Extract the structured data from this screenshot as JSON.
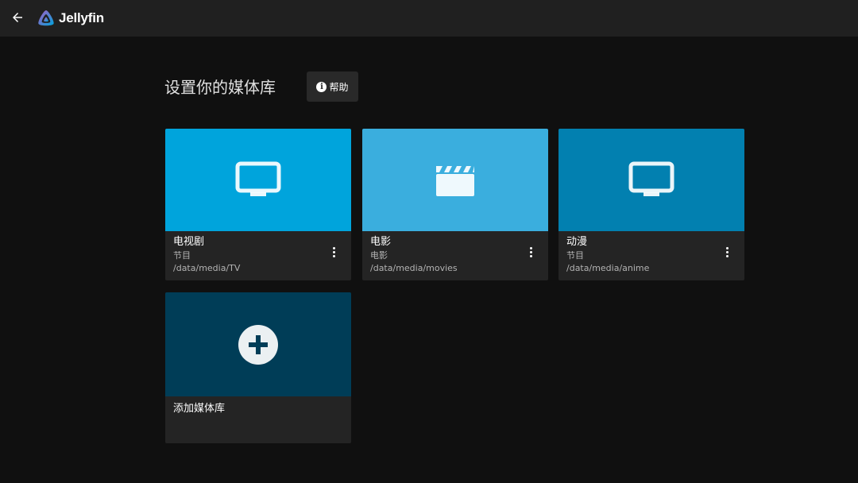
{
  "header": {
    "back_icon": "arrow-left-icon",
    "logo_text": "Jellyfin",
    "logo_icon": "jellyfin-logo-icon"
  },
  "page": {
    "title": "设置你的媒体库",
    "help_label": "帮助",
    "help_icon": "info-icon"
  },
  "libraries": [
    {
      "name": "电视剧",
      "type": "节目",
      "path": "/data/media/TV",
      "icon": "tv-icon",
      "color": "#00a4dc"
    },
    {
      "name": "电影",
      "type": "电影",
      "path": "/data/media/movies",
      "icon": "movie-clapperboard-icon",
      "color": "#3aaede"
    },
    {
      "name": "动漫",
      "type": "节目",
      "path": "/data/media/anime",
      "icon": "tv-icon",
      "color": "#0280b0"
    }
  ],
  "add_library": {
    "label": "添加媒体库",
    "icon": "add-circle-icon",
    "color": "#003d57"
  },
  "colors": {
    "background": "#101010",
    "header": "#202020",
    "card_footer": "#242424",
    "accent": "#00a4dc"
  }
}
